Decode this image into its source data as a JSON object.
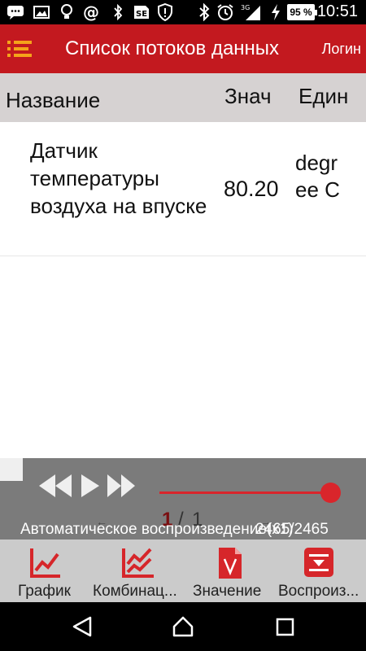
{
  "status_bar": {
    "time": "10:51",
    "battery_percent": "95 %",
    "network": "3G",
    "icons": [
      "message-icon",
      "image-icon",
      "bulb-icon",
      "at-icon",
      "bluetooth-icon",
      "sim-icon",
      "shield-icon",
      "bluetooth-icon",
      "alarm-icon",
      "signal-icon",
      "charging-icon",
      "battery-icon"
    ]
  },
  "toolbar": {
    "title": "Список потоков данных",
    "login_label": "Логин",
    "accent_color": "#c3191f"
  },
  "table": {
    "headers": {
      "name": "Название",
      "value": "Знач",
      "unit": "Един"
    },
    "rows": [
      {
        "name": "Датчик температуры воздуха на впуске",
        "value": "80.20",
        "unit": "degree C"
      }
    ]
  },
  "player": {
    "page_current": "1",
    "page_separator": "/",
    "page_total": "1",
    "auto_play_label": "Автоматическое воспроизведение(x1)",
    "counter": "2465/2465",
    "progress": 1.0,
    "accent_color": "#d9252b"
  },
  "tabs": [
    {
      "label": "График",
      "icon": "line-chart-icon"
    },
    {
      "label": "Комбинац...",
      "icon": "combined-chart-icon"
    },
    {
      "label": "Значение",
      "icon": "value-document-icon"
    },
    {
      "label": "Воспроиз...",
      "icon": "playback-icon"
    }
  ],
  "nav_bar": {
    "icons": [
      "back-icon",
      "home-icon",
      "recents-icon"
    ]
  }
}
